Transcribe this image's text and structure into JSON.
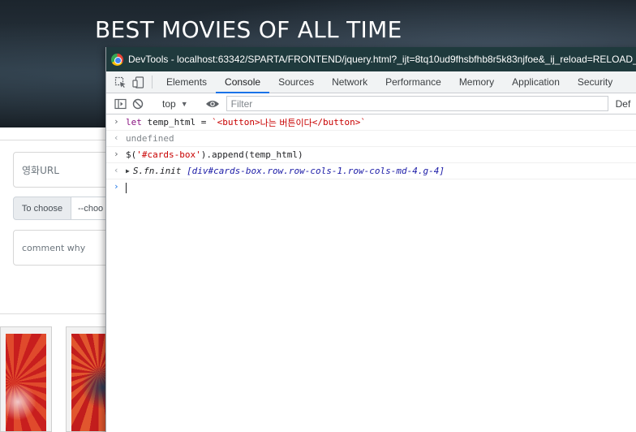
{
  "page": {
    "hero_title": "BEST MOVIES OF ALL TIME",
    "url_placeholder": "영화URL",
    "choose_label": "To choose",
    "choose_select_value": "--choo",
    "comment_placeholder": "comment why"
  },
  "devtools": {
    "window_title": "DevTools - localhost:63342/SPARTA/FRONTEND/jquery.html?_ijt=8tq10ud9fhsbfhb8r5k83njfoe&_ij_reload=RELOAD_",
    "tabs": [
      {
        "label": "Elements"
      },
      {
        "label": "Console"
      },
      {
        "label": "Sources"
      },
      {
        "label": "Network"
      },
      {
        "label": "Performance"
      },
      {
        "label": "Memory"
      },
      {
        "label": "Application"
      },
      {
        "label": "Security"
      }
    ],
    "active_tab": "Console",
    "context_value": "top",
    "filter_placeholder": "Filter",
    "default_levels_partial": "Def",
    "lines": {
      "l1_keyword": "let",
      "l1_rest": " temp_html = ",
      "l1_string_a": "`<button>",
      "l1_string_b": "나는 버튼이다",
      "l1_string_c": "</button>`",
      "l2_result": "undefined",
      "l3_a": "$(",
      "l3_selector": "'#cards-box'",
      "l3_b": ").append(temp_html)",
      "l4_name": "S.fn.init ",
      "l4_value": "[div#cards-box.row.row-cols-1.row-cols-md-4.g-4]"
    },
    "glyphs": {
      "input": "›",
      "output": "‹",
      "expand": "▶"
    }
  },
  "colors": {
    "titlebar": "#1f3a3d",
    "active_tab_underline": "#1a73e8",
    "keyword": "#881280",
    "string": "#c80000",
    "object_value": "#1a1aa6"
  }
}
